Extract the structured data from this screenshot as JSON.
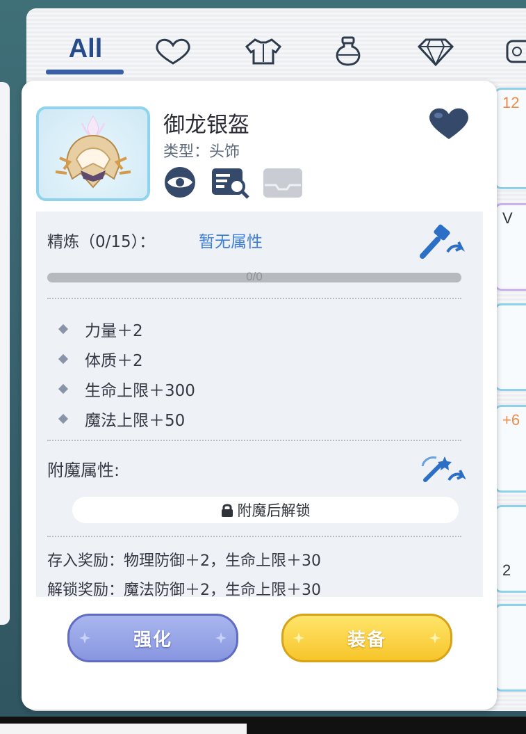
{
  "tabs": {
    "all_label": "All",
    "icons": [
      "heart-outline-icon",
      "armor-icon",
      "potion-icon",
      "gem-icon",
      "misc-icon"
    ]
  },
  "inventory_slots": [
    {
      "badge": "12"
    },
    {
      "badge": "V"
    },
    {
      "badge": ""
    },
    {
      "badge": "+6"
    },
    {
      "badge": "2"
    },
    {
      "badge": ""
    }
  ],
  "item": {
    "name": "御龙银盔",
    "type": "类型：头饰",
    "favorite": true
  },
  "refine": {
    "label": "精炼（0/15）：",
    "value": "暂无属性",
    "progress_text": "0/0",
    "progress": 0
  },
  "stats": [
    "力量＋2",
    "体质＋2",
    "生命上限＋300",
    "魔法上限＋50"
  ],
  "enchant": {
    "label": "附魔属性:",
    "locked_text": "附魔后解锁"
  },
  "rewards": {
    "deposit": "存入奖励：物理防御＋2，生命上限＋30",
    "unlock": "解锁奖励：魔法防御＋2，生命上限＋30"
  },
  "buttons": {
    "enhance": "强化",
    "equip": "装备"
  },
  "colors": {
    "accent_blue": "#3f7fd7",
    "tab_active": "#274a8b",
    "frame_border": "#8fd3ee",
    "enhance_btn": "#8896e0",
    "equip_btn": "#f7c52a"
  }
}
